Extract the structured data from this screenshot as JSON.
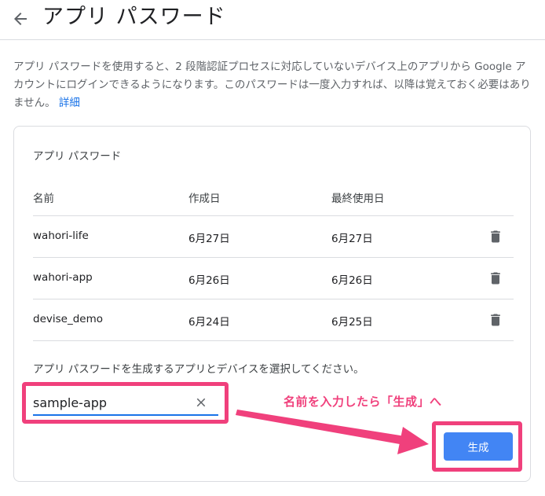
{
  "header": {
    "title": "アプリ パスワード"
  },
  "description": {
    "text": "アプリ パスワードを使用すると、2 段階認証プロセスに対応していないデバイス上のアプリから Google アカウントにログインできるようになります。このパスワードは一度入力すれば、以降は覚えておく必要はありません。",
    "link": "詳細"
  },
  "card": {
    "title": "アプリ パスワード",
    "columns": [
      "名前",
      "作成日",
      "最終使用日"
    ],
    "rows": [
      {
        "name": "wahori-life",
        "created": "6月27日",
        "last_used": "6月27日"
      },
      {
        "name": "wahori-app",
        "created": "6月26日",
        "last_used": "6月26日"
      },
      {
        "name": "devise_demo",
        "created": "6月24日",
        "last_used": "6月25日"
      }
    ],
    "select_label": "アプリ パスワードを生成するアプリとデバイスを選択してください。",
    "input_value": "sample-app",
    "generate_label": "生成"
  },
  "annotation": {
    "text": "名前を入力したら「生成」へ",
    "color": "#f0407c"
  },
  "colors": {
    "accent": "#1a73e8",
    "button": "#4285f4",
    "highlight": "#f0407c"
  }
}
